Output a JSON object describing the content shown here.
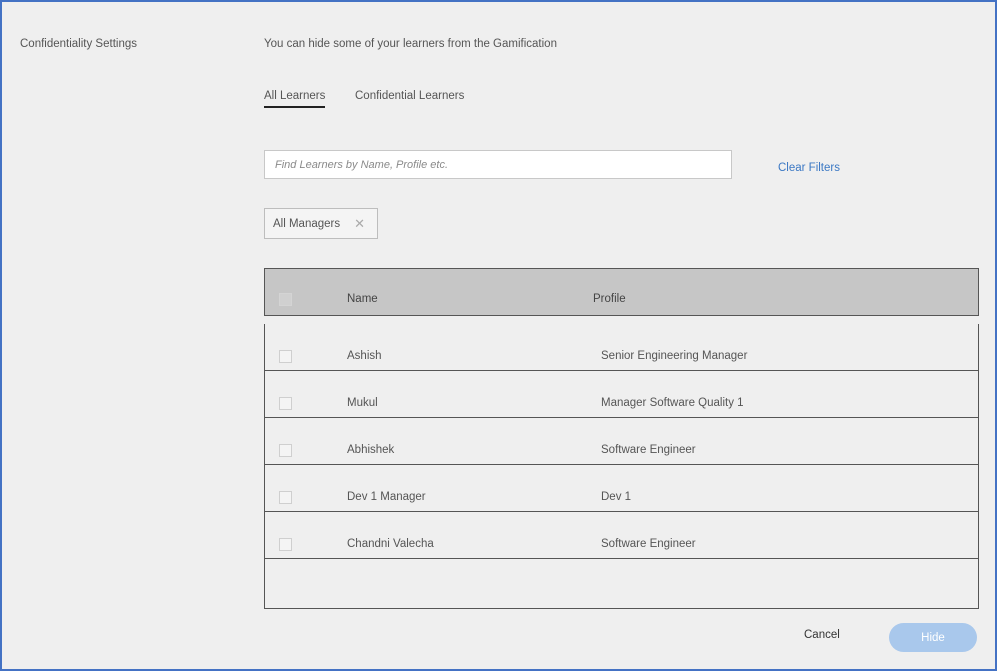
{
  "section_label": "Confidentiality Settings",
  "intro_text": "You can hide some of your learners from the Gamification",
  "tabs": [
    {
      "label": "All Learners",
      "active": true
    },
    {
      "label": "Confidential Learners",
      "active": false
    }
  ],
  "search": {
    "placeholder": "Find Learners by Name, Profile etc.",
    "value": ""
  },
  "clear_filters_label": "Clear Filters",
  "filter_chip": {
    "label": "All Managers",
    "remove_icon": "close-icon"
  },
  "table": {
    "columns": [
      "Name",
      "Profile"
    ],
    "rows": [
      {
        "name": "Ashish",
        "profile": "Senior Engineering Manager",
        "checked": false
      },
      {
        "name": "Mukul",
        "profile": "Manager Software Quality 1",
        "checked": false
      },
      {
        "name": "Abhishek",
        "profile": "Software Engineer",
        "checked": false
      },
      {
        "name": "Dev 1 Manager",
        "profile": "Dev 1",
        "checked": false
      },
      {
        "name": "Chandni Valecha",
        "profile": "Software Engineer",
        "checked": false
      }
    ]
  },
  "actions": {
    "cancel_label": "Cancel",
    "hide_label": "Hide"
  },
  "colors": {
    "accent": "#3b78c4",
    "hide_button": "#a9c8ec",
    "header_bg": "#c6c6c6",
    "frame_border": "#4472c4"
  }
}
